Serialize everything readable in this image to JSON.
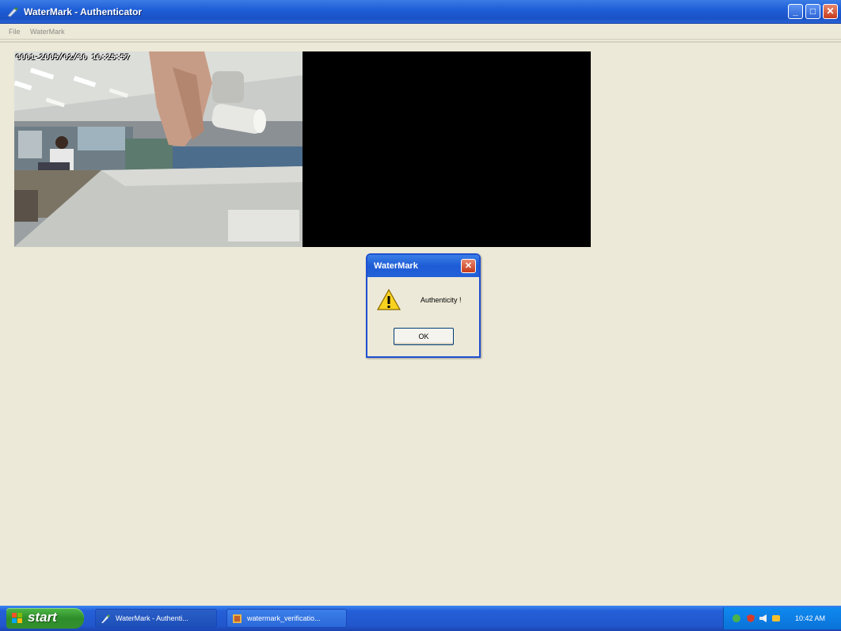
{
  "window": {
    "title": "WaterMark - Authenticator",
    "minimize_glyph": "_",
    "maximize_glyph": "□",
    "close_glyph": "✕"
  },
  "menu": {
    "items": [
      "File",
      "WaterMark"
    ]
  },
  "video": {
    "timestamp": "C001-2005/02/30 10:25:57"
  },
  "dialog": {
    "title": "WaterMark",
    "close_glyph": "✕",
    "message": "Authenticity !",
    "ok_label": "OK",
    "icon": "warning-icon"
  },
  "taskbar": {
    "start_label": "start",
    "tasks": [
      {
        "label": "WaterMark - Authenti...",
        "icon": "pen-icon"
      },
      {
        "label": "watermark_verificatio...",
        "icon": "app-icon"
      }
    ],
    "clock": "10:42 AM"
  },
  "colors": {
    "titlebar": "#1f5fd8",
    "taskbar": "#2256cc",
    "start": "#2e8e2a",
    "window_bg": "#ece9d8"
  }
}
